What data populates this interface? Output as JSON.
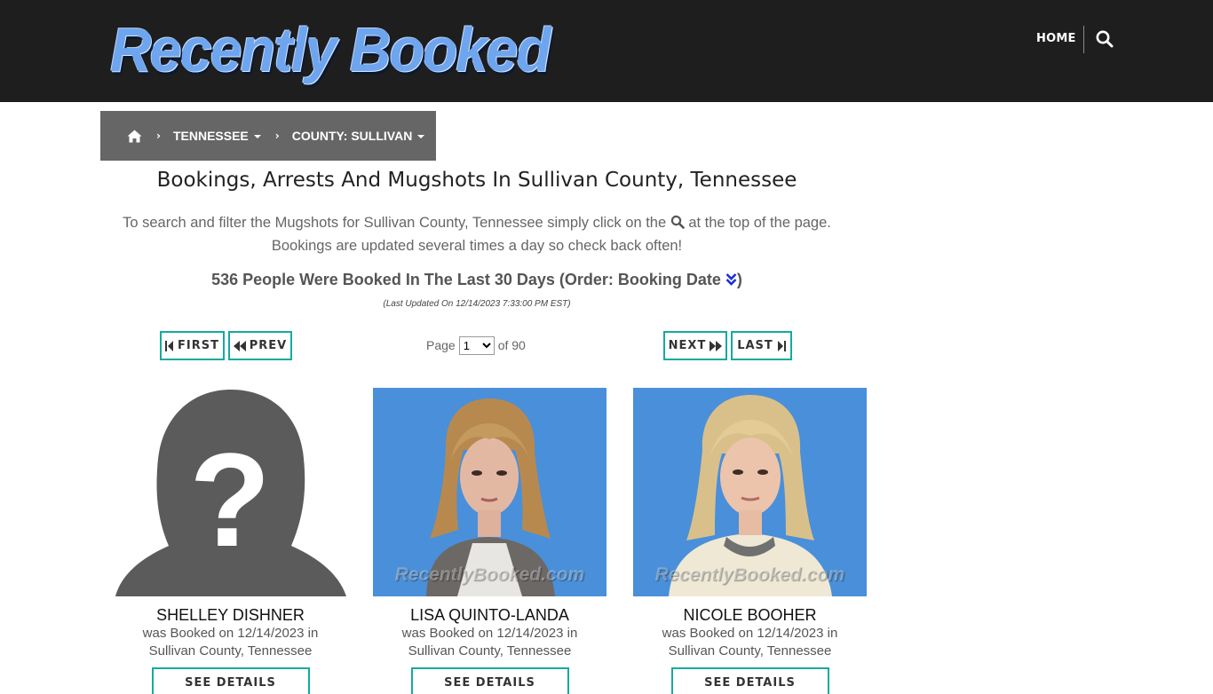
{
  "header": {
    "logo_text": "Recently Booked",
    "nav_home": "HOME",
    "search_icon": "search-icon"
  },
  "breadcrumb": {
    "home_icon": "home-icon",
    "state": "TENNESSEE",
    "county": "COUNTY: SULLIVAN"
  },
  "main": {
    "title": "Bookings, Arrests And Mugshots In Sullivan County, Tennessee",
    "desc_part1": "To search and filter the Mugshots for Sullivan County, Tennessee simply click on the",
    "desc_part2": "at the top of the page.",
    "desc_line2": "Bookings are updated several times a day so check back often!",
    "count_text": "536 People Were Booked In The Last 30 Days (Order: Booking Date",
    "count_close": ")",
    "last_updated": "(Last Updated On 12/14/2023 7:33:00 PM EST)"
  },
  "pagination": {
    "first": "FIRST",
    "prev": "PREV",
    "next": "NEXT",
    "last": "LAST",
    "page_label": "Page",
    "current_page": "1",
    "of_label": "of 90"
  },
  "cards": [
    {
      "name": "SHELLEY DISHNER",
      "booked": "was Booked on 12/14/2023 in",
      "location": "Sullivan County, Tennessee",
      "details": "SEE DETAILS",
      "watermark": ""
    },
    {
      "name": "LISA QUINTO-LANDA",
      "booked": "was Booked on 12/14/2023 in",
      "location": "Sullivan County, Tennessee",
      "details": "SEE DETAILS",
      "watermark": "RecentlyBooked.com"
    },
    {
      "name": "NICOLE BOOHER",
      "booked": "was Booked on 12/14/2023 in",
      "location": "Sullivan County, Tennessee",
      "details": "SEE DETAILS",
      "watermark": "RecentlyBooked.com"
    }
  ],
  "colors": {
    "header_bg": "#1e1e1e",
    "accent": "#17a9a0",
    "breadcrumb_bg": "#666666",
    "mugshot_bg": "#4a8fd9"
  }
}
